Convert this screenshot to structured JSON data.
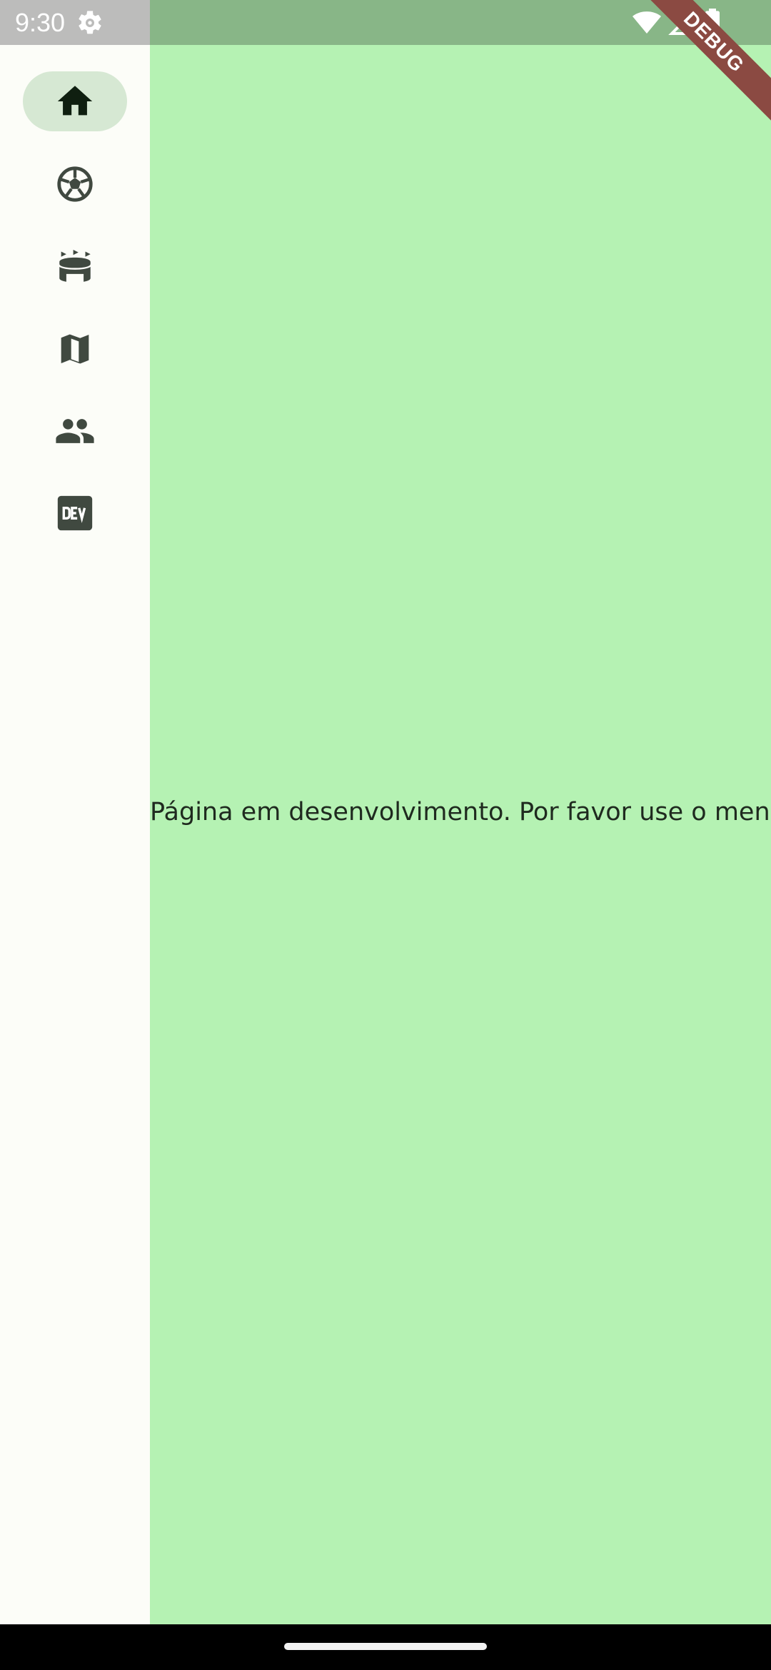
{
  "status_bar": {
    "time": "9:30"
  },
  "debug_banner": {
    "label": "DEBUG"
  },
  "rail": {
    "items": [
      {
        "icon": "home-icon",
        "selected": true
      },
      {
        "icon": "soccer-ball-icon",
        "selected": false
      },
      {
        "icon": "stadium-icon",
        "selected": false
      },
      {
        "icon": "map-icon",
        "selected": false
      },
      {
        "icon": "people-icon",
        "selected": false
      },
      {
        "icon": "dev-icon",
        "selected": false
      }
    ]
  },
  "main": {
    "message": "Página em desenvolvimento. Por favor use o menu."
  },
  "colors": {
    "content_background": "#b5f2b3",
    "rail_background": "#fcfdf8",
    "rail_selected_indicator": "#d6e8d3",
    "icon_color": "#404940",
    "debug_banner": "#8b4a42"
  }
}
